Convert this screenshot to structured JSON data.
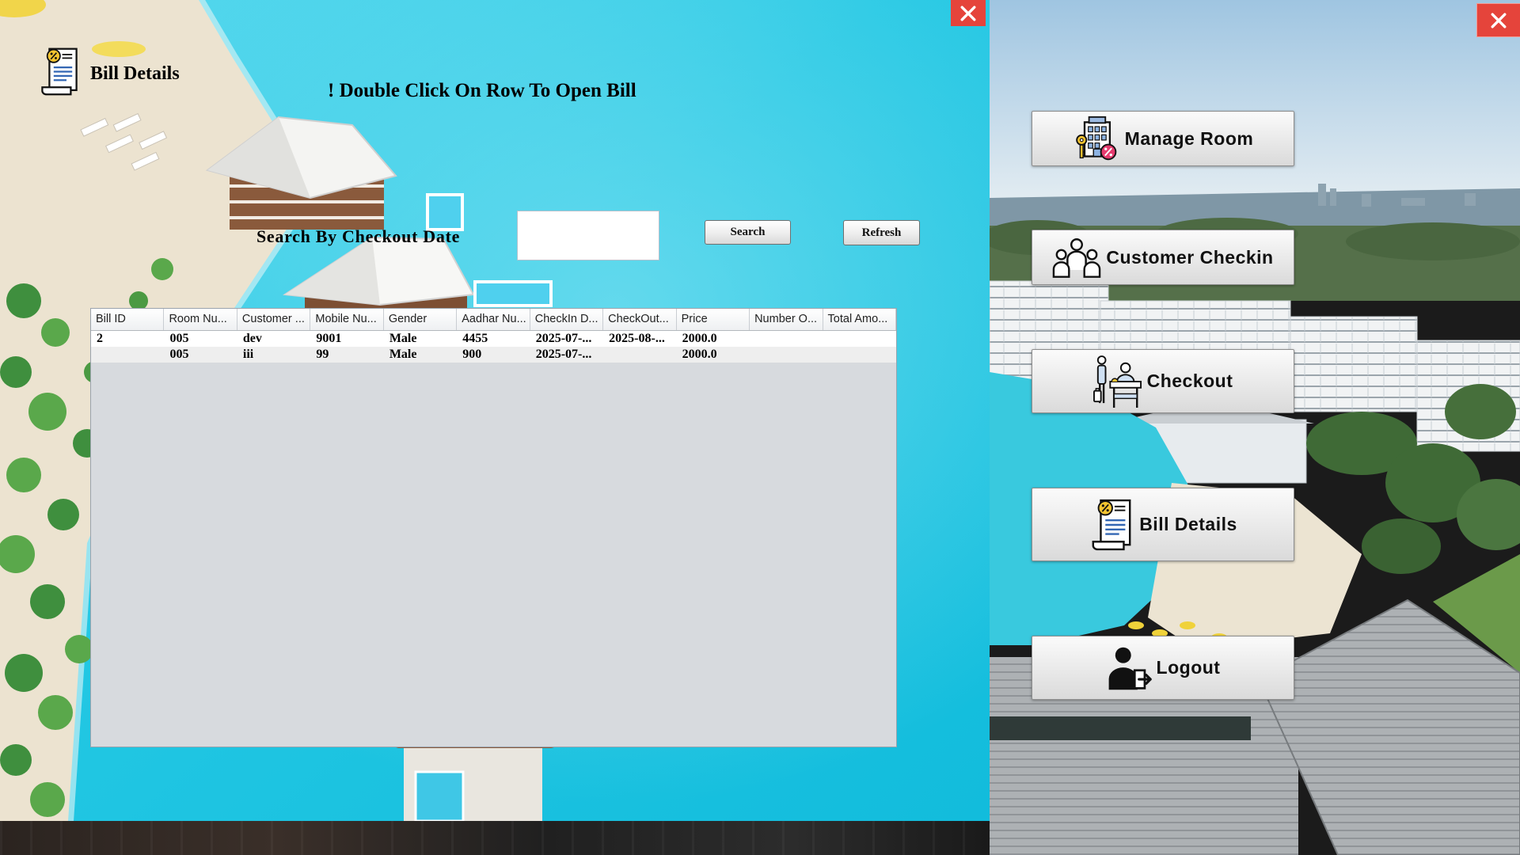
{
  "bill_window": {
    "title": "Bill Details",
    "title_icon": "bill-document-icon",
    "hint": "! Double Click On Row To Open Bill",
    "search_label": "Search By Checkout Date",
    "search_value": "",
    "search_button": "Search",
    "refresh_button": "Refresh",
    "close_icon": "close-icon",
    "table": {
      "columns": [
        "Bill ID",
        "Room Nu...",
        "Customer ...",
        "Mobile Nu...",
        "Gender",
        "Aadhar Nu...",
        "CheckIn D...",
        "CheckOut...",
        "Price",
        "Number O...",
        "Total Amo..."
      ],
      "rows": [
        [
          "2",
          "005",
          "dev",
          "9001",
          "Male",
          "4455",
          "2025-07-...",
          "2025-08-...",
          "2000.0",
          "",
          ""
        ],
        [
          "",
          "005",
          "iii",
          "99",
          "Male",
          "900",
          "2025-07-...",
          "",
          "2000.0",
          "",
          ""
        ]
      ]
    }
  },
  "menu": {
    "items": [
      {
        "label": "Manage Room",
        "icon": "hotel-key-icon"
      },
      {
        "label": "Customer Checkin",
        "icon": "customers-group-icon"
      },
      {
        "label": "Checkout",
        "icon": "checkout-desk-icon"
      },
      {
        "label": "Bill Details",
        "icon": "bill-document-icon"
      },
      {
        "label": "Logout",
        "icon": "logout-user-icon"
      }
    ]
  },
  "app_close_icon": "close-icon",
  "colors": {
    "close_button": "#e5443b",
    "close_icon": "#ffffff",
    "table_body": "#d7dade",
    "table_row_alt": "#eeeeee"
  }
}
